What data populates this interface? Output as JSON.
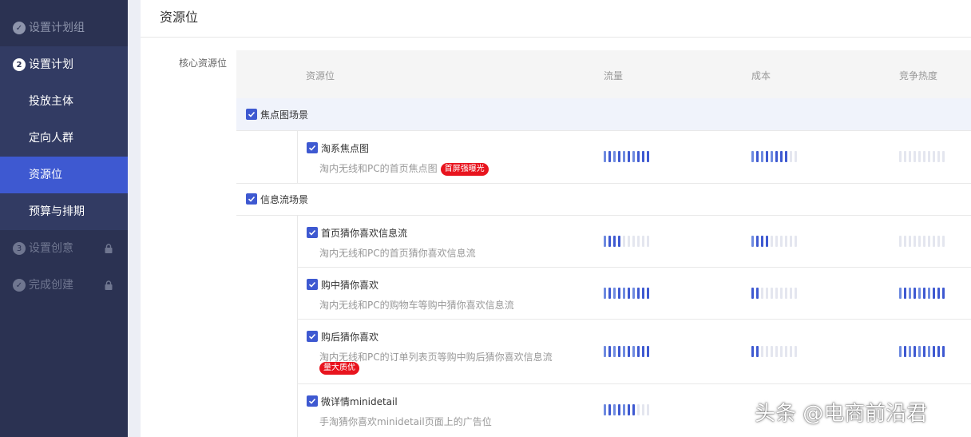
{
  "sidebar": {
    "steps": [
      {
        "label": "设置计划组",
        "state": "done",
        "mark": "✓"
      },
      {
        "label": "设置计划",
        "state": "current",
        "mark": "2"
      },
      {
        "label": "设置创意",
        "state": "locked",
        "mark": "3"
      },
      {
        "label": "完成创建",
        "state": "locked",
        "mark": "✓"
      }
    ],
    "substeps": [
      {
        "label": "投放主体"
      },
      {
        "label": "定向人群"
      },
      {
        "label": "资源位",
        "active": true
      },
      {
        "label": "预算与排期"
      }
    ]
  },
  "page": {
    "title": "资源位",
    "group_label": "核心资源位"
  },
  "table": {
    "headers": [
      "资源位",
      "流量",
      "成本",
      "竞争热度"
    ],
    "scenes": [
      {
        "label": "焦点图场景",
        "items": [
          {
            "name": "淘系焦点图",
            "desc": "淘内无线和PC的首页焦点图",
            "badge": "首屏强曝光",
            "traffic": 10,
            "cost": 8,
            "competition": 0
          }
        ]
      },
      {
        "label": "信息流场景",
        "items": [
          {
            "name": "首页猜你喜欢信息流",
            "desc": "淘内无线和PC的首页猜你喜欢信息流",
            "badge": "",
            "traffic": 4,
            "cost": 4,
            "competition": 0
          },
          {
            "name": "购中猜你喜欢",
            "desc": "淘内无线和PC的购物车等购中猜你喜欢信息流",
            "badge": "",
            "traffic": 10,
            "cost": 2,
            "competition": 10
          },
          {
            "name": "购后猜你喜欢",
            "desc": "淘内无线和PC的订单列表页等购中购后猜你喜欢信息流",
            "badge": "量大质优",
            "traffic": 10,
            "cost": 2,
            "competition": 10
          },
          {
            "name": "微详情minidetail",
            "desc": "手淘猜你喜欢minidetail页面上的广告位",
            "badge": "",
            "traffic": 7,
            "cost": 0,
            "competition": 0
          }
        ]
      }
    ],
    "bar_total": 10
  },
  "watermark": "头条 @电商前沿君",
  "colors": {
    "accent": "#3e59d1",
    "sidebar": "#2b3252",
    "badge": "#e8141e"
  }
}
